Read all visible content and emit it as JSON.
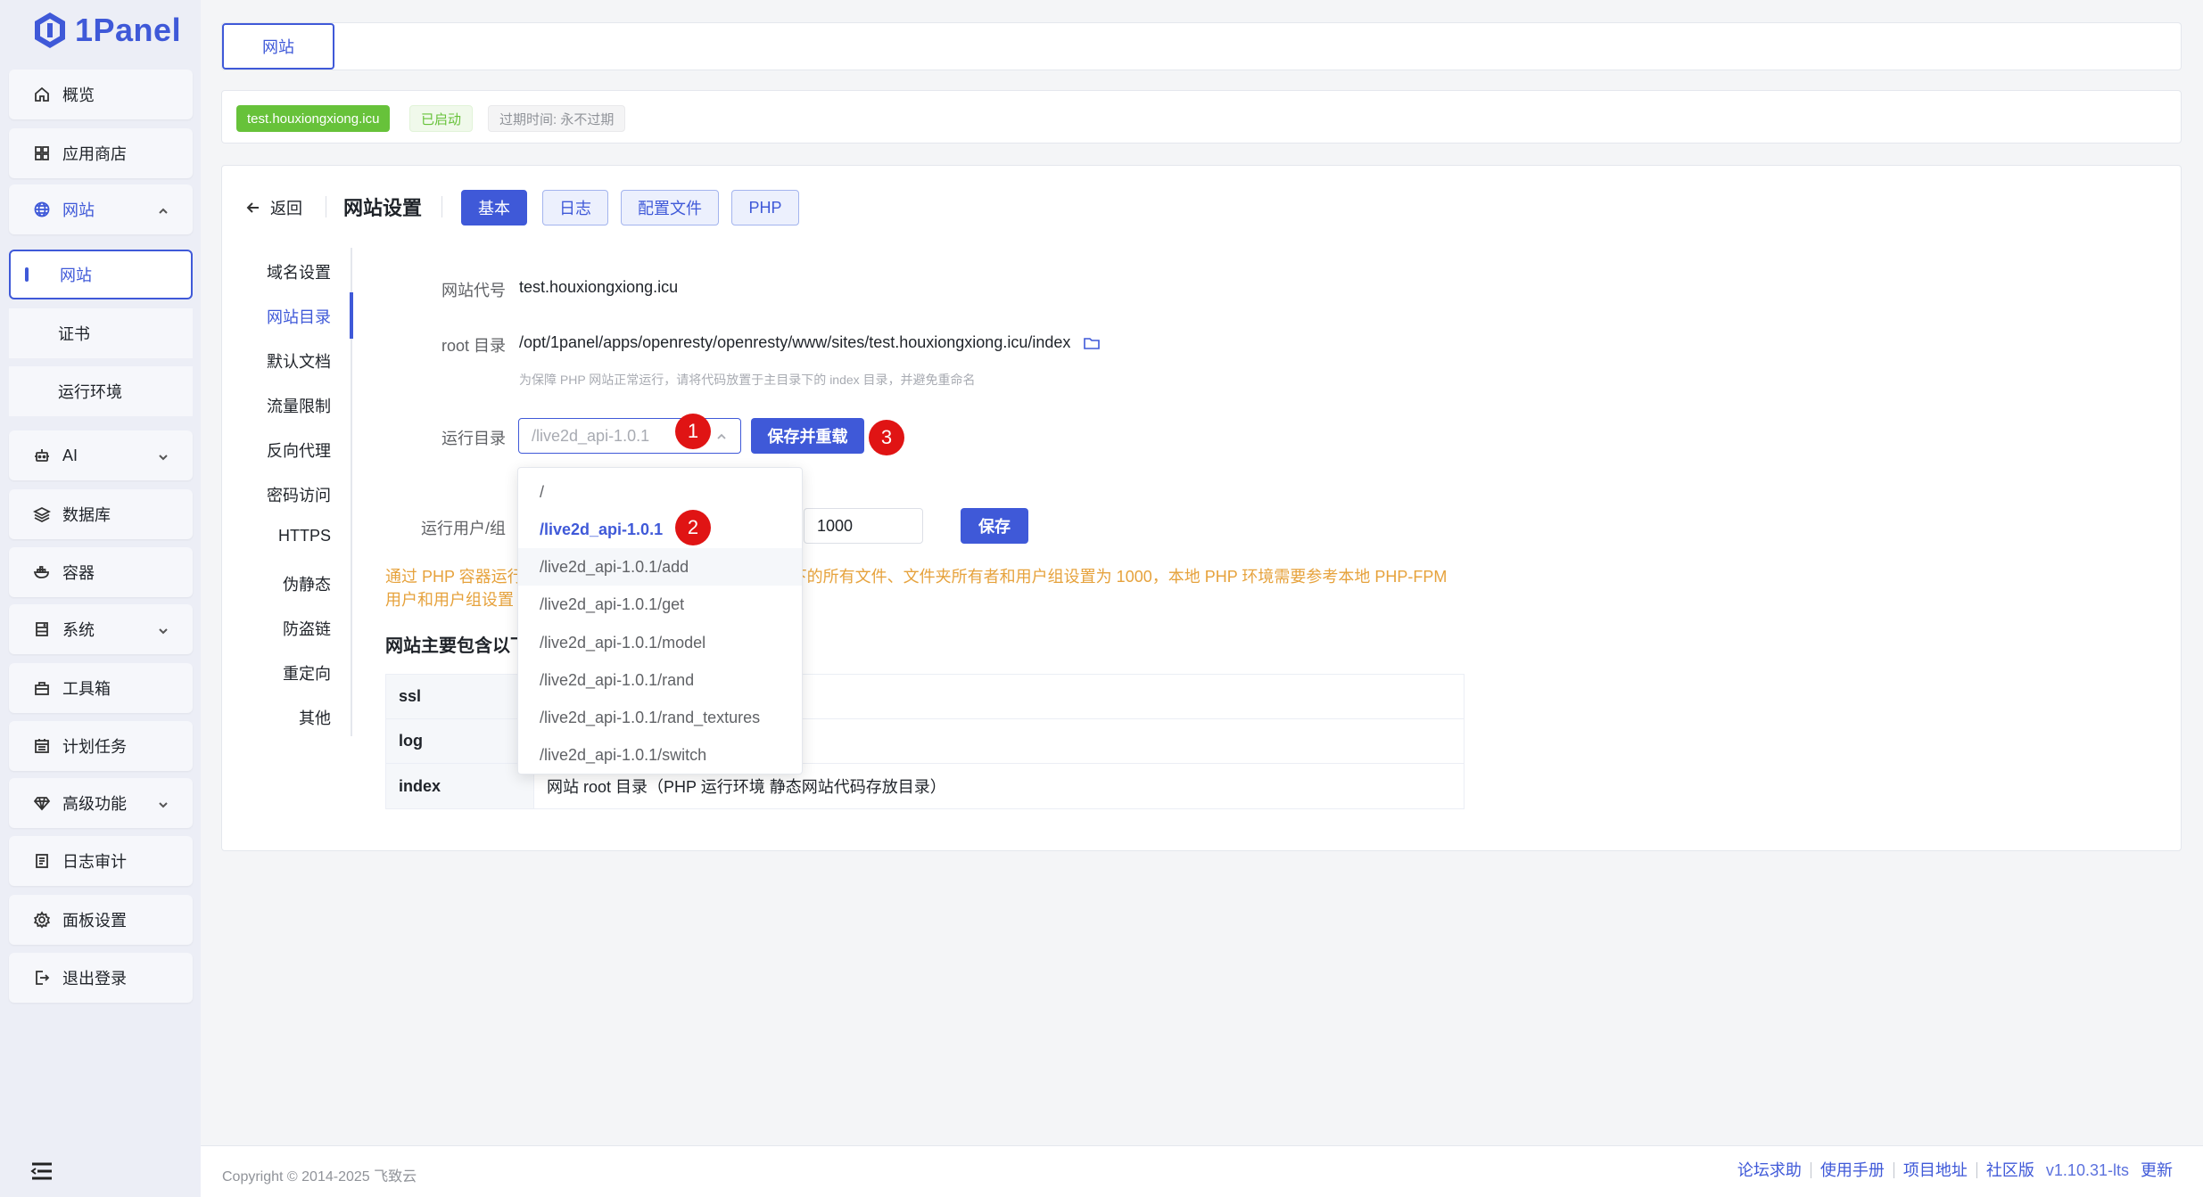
{
  "app": {
    "logo_text": "1Panel"
  },
  "sidebar": {
    "items": [
      {
        "label": "概览",
        "icon": "home-icon"
      },
      {
        "label": "应用商店",
        "icon": "grid-icon"
      },
      {
        "label": "网站",
        "icon": "globe-icon",
        "expanded": true
      },
      {
        "label": "AI",
        "icon": "robot-icon"
      },
      {
        "label": "数据库",
        "icon": "database-icon"
      },
      {
        "label": "容器",
        "icon": "docker-icon"
      },
      {
        "label": "系统",
        "icon": "server-icon"
      },
      {
        "label": "工具箱",
        "icon": "toolbox-icon"
      },
      {
        "label": "计划任务",
        "icon": "calendar-icon"
      },
      {
        "label": "高级功能",
        "icon": "diamond-icon"
      },
      {
        "label": "日志审计",
        "icon": "log-icon"
      },
      {
        "label": "面板设置",
        "icon": "gear-icon"
      },
      {
        "label": "退出登录",
        "icon": "logout-icon"
      }
    ],
    "sub_items": [
      {
        "label": "网站",
        "active": true
      },
      {
        "label": "证书"
      },
      {
        "label": "运行环境"
      }
    ]
  },
  "top_tab": {
    "label": "网站"
  },
  "status": {
    "domain": "test.houxiongxiong.icu",
    "state": "已启动",
    "expire": "过期时间: 永不过期"
  },
  "settings": {
    "back_label": "返回",
    "title": "网站设置",
    "tabs": [
      "基本",
      "日志",
      "配置文件",
      "PHP"
    ],
    "leftnav": [
      "域名设置",
      "网站目录",
      "默认文档",
      "流量限制",
      "反向代理",
      "密码访问",
      "HTTPS",
      "伪静态",
      "防盗链",
      "重定向",
      "其他"
    ],
    "site_code_label": "网站代号",
    "site_code": "test.houxiongxiong.icu",
    "root_label": "root 目录",
    "root_path": "/opt/1panel/apps/openresty/openresty/www/sites/test.houxiongxiong.icu/index",
    "root_hint": "为保障 PHP 网站正常运行，请将代码放置于主目录下的 index 目录，并避免重命名",
    "run_dir_label": "运行目录",
    "run_dir_placeholder": "/live2d_api-1.0.1",
    "save_reload": "保存并重载",
    "run_user_label": "运行用户/组",
    "run_group_value": "1000",
    "save": "保存",
    "warning": "通过 PHP 容器运行的网站，需要将 index 和运行目录下的所有文件、文件夹所有者和用户组设置为 1000，本地 PHP 环境需要参考本地 PHP-FPM 用户和用户组设置",
    "warning_visible_prefix": "通过 PHP 容器运行",
    "warning_visible_suffix": "下的所有文件、文件夹所有者和用户组设置为 1000，本地 PHP 环境需要参考本地 PHP-FPM 用户和用户组设置",
    "section_title": "网站主要包含以下",
    "table": [
      {
        "key": "ssl",
        "value": ""
      },
      {
        "key": "log",
        "value": ""
      },
      {
        "key": "index",
        "value": "网站 root 目录（PHP 运行环境 静态网站代码存放目录）"
      }
    ],
    "dropdown": [
      "/",
      "/live2d_api-1.0.1",
      "/live2d_api-1.0.1/add",
      "/live2d_api-1.0.1/get",
      "/live2d_api-1.0.1/model",
      "/live2d_api-1.0.1/rand",
      "/live2d_api-1.0.1/rand_textures",
      "/live2d_api-1.0.1/switch"
    ],
    "markers": [
      "1",
      "2",
      "3"
    ]
  },
  "footer": {
    "copyright": "Copyright © 2014-2025 飞致云",
    "links": [
      "论坛求助",
      "使用手册",
      "项目地址",
      "社区版"
    ],
    "version": "v1.10.31-lts",
    "update": "更新"
  },
  "colors": {
    "accent": "#3f59d8",
    "success": "#67c23a",
    "warning": "#e6a23c",
    "marker": "#e01414"
  }
}
